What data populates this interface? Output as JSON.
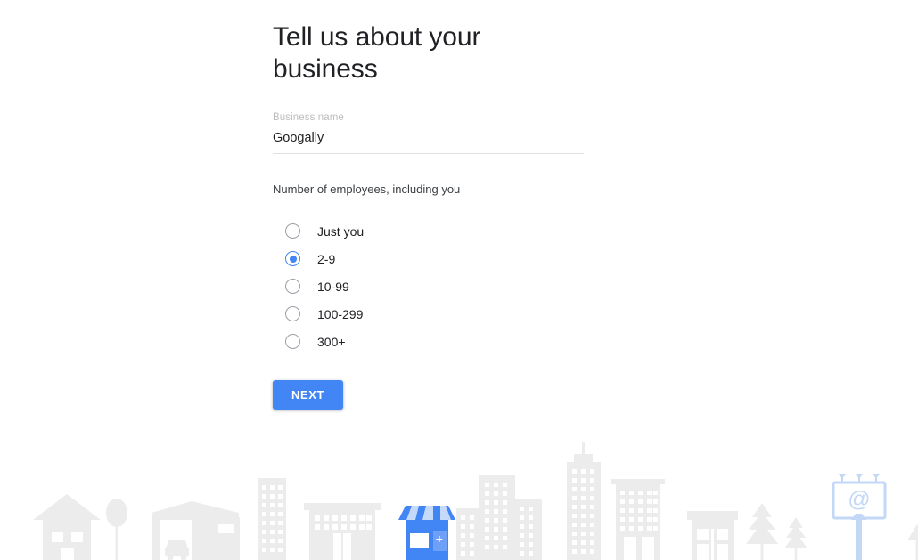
{
  "page": {
    "title": "Tell us about your business"
  },
  "business_name_field": {
    "label": "Business name",
    "value": "Googally",
    "placeholder": "Business name"
  },
  "employees_group": {
    "label": "Number of employees, including you",
    "selected_value": "2-9",
    "options": [
      {
        "label": "Just you",
        "selected": false
      },
      {
        "label": "2-9",
        "selected": true
      },
      {
        "label": "10-99",
        "selected": false
      },
      {
        "label": "100-299",
        "selected": false
      },
      {
        "label": "300+",
        "selected": false
      }
    ]
  },
  "actions": {
    "next_label": "NEXT"
  },
  "illustration": {
    "name": "city-skyline-illustration",
    "billboard_text": "@",
    "colors": {
      "building_gray": "#ececec",
      "accent_blue": "#4285f4",
      "light_blue": "#a9c7f5",
      "billboard_outline": "#c3d7f7",
      "window_white": "#ffffff"
    }
  },
  "theme": {
    "accent": "#4285f4",
    "title_color": "#202124",
    "label_gray": "#bdbdbd",
    "text_dark": "#3c4043",
    "underline": "#e0e0e0"
  }
}
